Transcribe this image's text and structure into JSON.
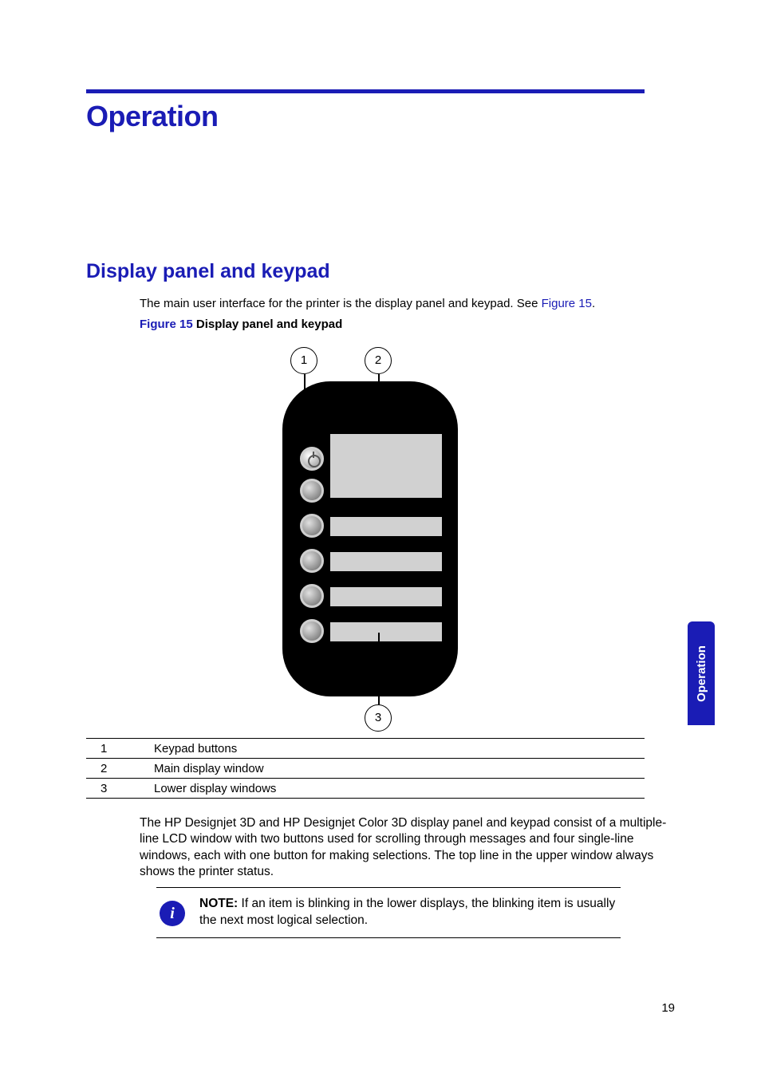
{
  "header": {
    "title": "Operation"
  },
  "section": {
    "title": "Display panel and keypad"
  },
  "intro": {
    "text_prefix": "The main user interface for the printer is the display panel and keypad. See ",
    "link_text": "Figure 15",
    "text_suffix": "."
  },
  "figure": {
    "label": "Figure 15",
    "title": "Display panel and keypad",
    "callouts": {
      "c1": "1",
      "c2": "2",
      "c3": "3"
    }
  },
  "legend": [
    {
      "num": "1",
      "text": "Keypad buttons"
    },
    {
      "num": "2",
      "text": "Main display window"
    },
    {
      "num": "3",
      "text": "Lower display windows"
    }
  ],
  "body_para": "The HP Designjet 3D and HP Designjet Color 3D display panel and keypad consist of a multiple-line LCD window with two buttons used for scrolling through messages and four single-line windows, each with one button for making selections. The top line in the upper window always shows the printer status.",
  "note": {
    "icon_glyph": "i",
    "label": "NOTE:",
    "text": " If an item is blinking in the lower displays, the blinking item is usually the next most logical selection."
  },
  "side_tab": "Operation",
  "page_number": "19"
}
